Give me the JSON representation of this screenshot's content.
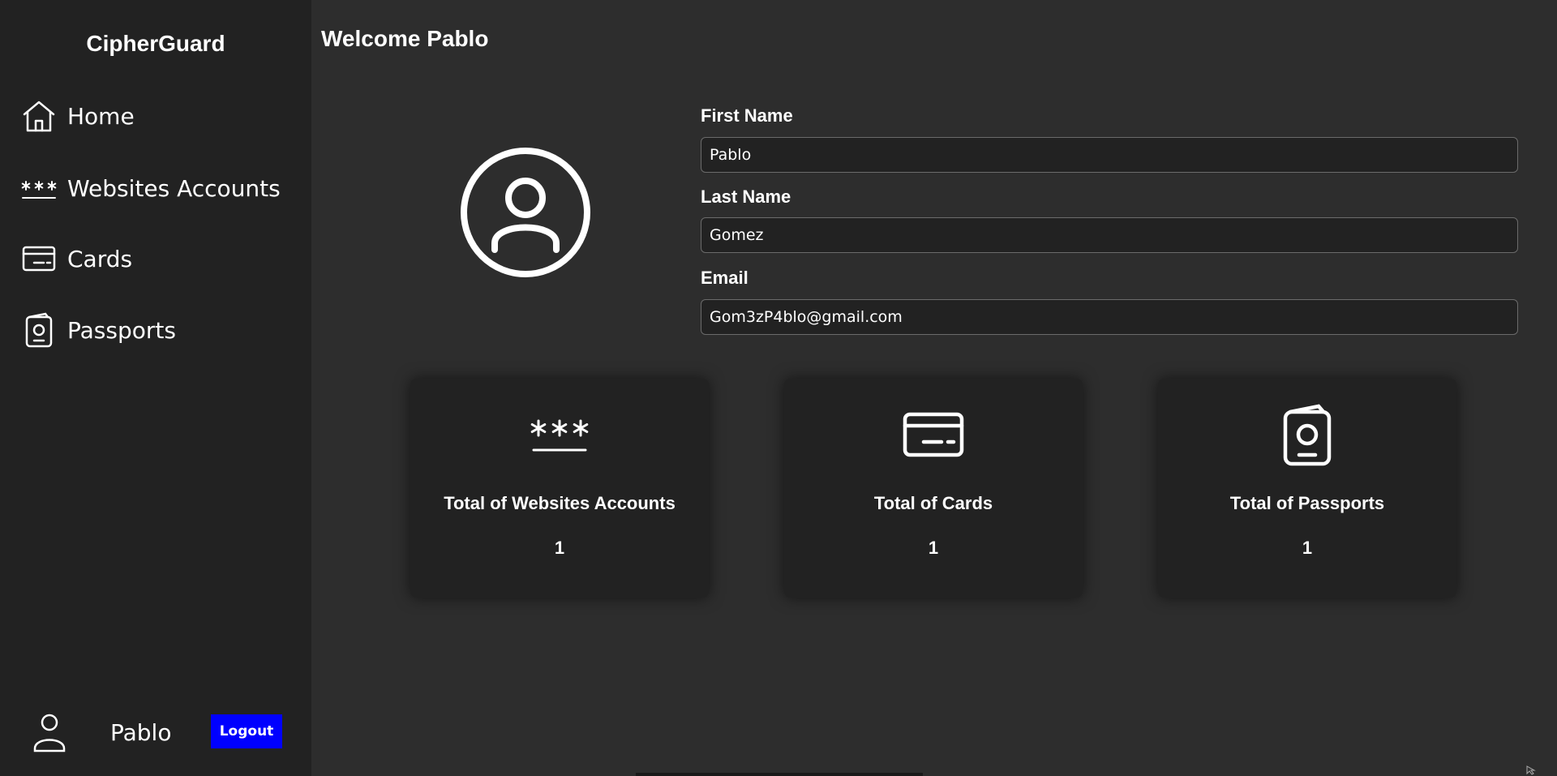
{
  "app": {
    "brand": "CipherGuard"
  },
  "sidebar": {
    "items": [
      {
        "label": "Home",
        "icon": "home-icon"
      },
      {
        "label": "Websites Accounts",
        "icon": "password-icon"
      },
      {
        "label": "Cards",
        "icon": "credit-card-icon"
      },
      {
        "label": "Passports",
        "icon": "passport-icon"
      }
    ],
    "footer": {
      "user_name": "Pablo",
      "logout_label": "Logout",
      "logout_color": "#0000ff"
    }
  },
  "main": {
    "title": "Welcome Pablo",
    "form": {
      "first_name": {
        "label": "First Name",
        "value": "Pablo"
      },
      "last_name": {
        "label": "Last Name",
        "value": "Gomez"
      },
      "email": {
        "label": "Email",
        "value": "Gom3zP4blo@gmail.com"
      }
    },
    "cards": [
      {
        "title": "Total of Websites Accounts",
        "count": "1",
        "icon": "password-icon"
      },
      {
        "title": "Total of Cards",
        "count": "1",
        "icon": "credit-card-icon"
      },
      {
        "title": "Total of Passports",
        "count": "1",
        "icon": "passport-icon"
      }
    ]
  },
  "colors": {
    "sidebar_bg": "#222222",
    "main_bg": "#2d2d2d",
    "text": "#ffffff"
  }
}
